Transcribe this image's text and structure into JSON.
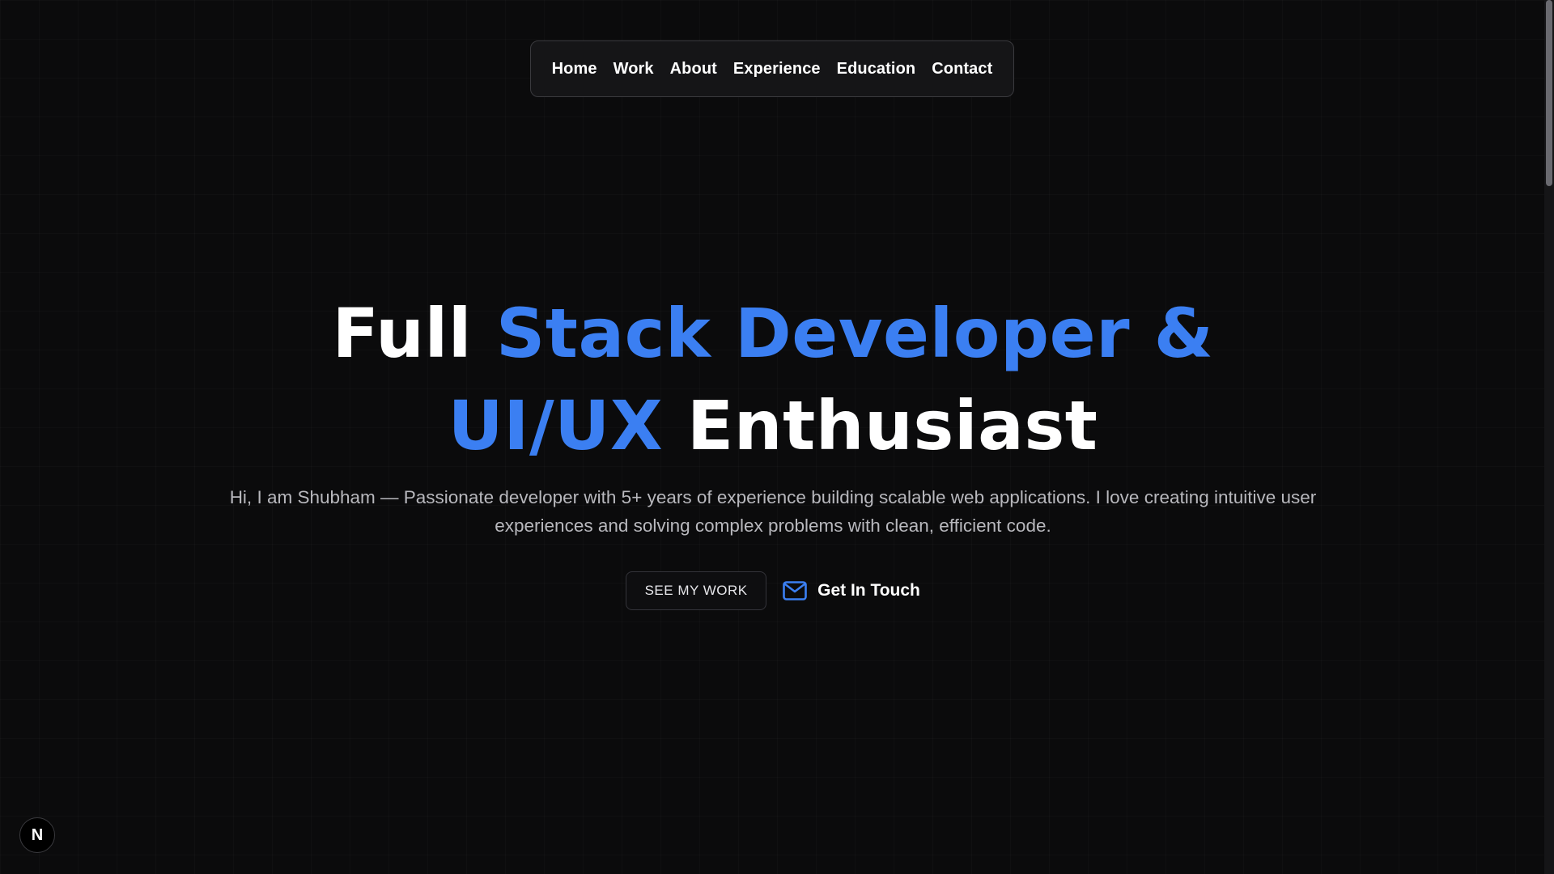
{
  "nav": {
    "items": [
      {
        "label": "Home"
      },
      {
        "label": "Work"
      },
      {
        "label": "About"
      },
      {
        "label": "Experience"
      },
      {
        "label": "Education"
      },
      {
        "label": "Contact"
      }
    ]
  },
  "hero": {
    "title": {
      "line1_white": "Full ",
      "line1_accent": "Stack Developer &",
      "line2_accent": "UI/UX",
      "line2_white": " Enthusiast"
    },
    "subtitle": "Hi, I am Shubham — Passionate developer with 5+ years of experience building scalable web applications. I love creating intuitive user experiences and solving complex problems with clean, efficient code.",
    "primary_button": "SEE MY WORK",
    "secondary_button": "Get In Touch",
    "secondary_button_icon": "mail-icon"
  },
  "badge": {
    "letter": "N",
    "icon": "nextjs-logo-icon"
  },
  "colors": {
    "background": "#0b0b0c",
    "accent": "#3b7ff2",
    "text": "#ffffff",
    "muted_text": "#b8b8bd"
  }
}
